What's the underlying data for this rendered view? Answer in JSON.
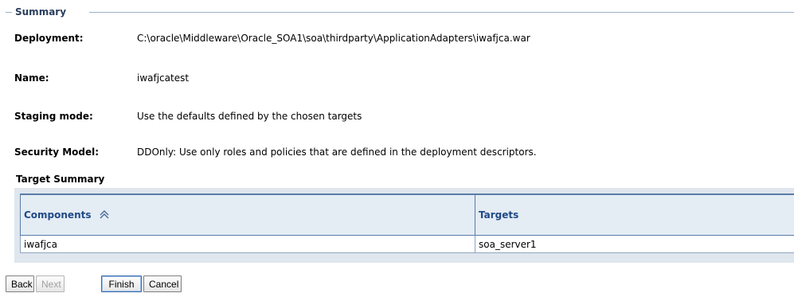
{
  "summary": {
    "title": "Summary",
    "fields": [
      {
        "label": "Deployment:",
        "value": "C:\\oracle\\Middleware\\Oracle_SOA1\\soa\\thirdparty\\ApplicationAdapters\\iwafjca.war"
      },
      {
        "label": "Name:",
        "value": "iwafjcatest"
      },
      {
        "label": "Staging mode:",
        "value": "Use the defaults defined by the chosen targets"
      },
      {
        "label": "Security Model:",
        "value": "DDOnly: Use only roles and policies that are defined in the deployment descriptors."
      }
    ]
  },
  "target_summary": {
    "title": "Target Summary",
    "columns": [
      "Components",
      "Targets"
    ],
    "sort_icon": "sort-ascending-icon",
    "rows": [
      {
        "component": "iwafjca",
        "target": "soa_server1"
      }
    ]
  },
  "buttons": {
    "back": "Back",
    "next": "Next",
    "finish": "Finish",
    "cancel": "Cancel"
  },
  "colors": {
    "header_text": "#1f4a86",
    "header_bg": "#e4ecf4",
    "border": "#5a7ca6",
    "section_title": "#2a3e5c"
  }
}
